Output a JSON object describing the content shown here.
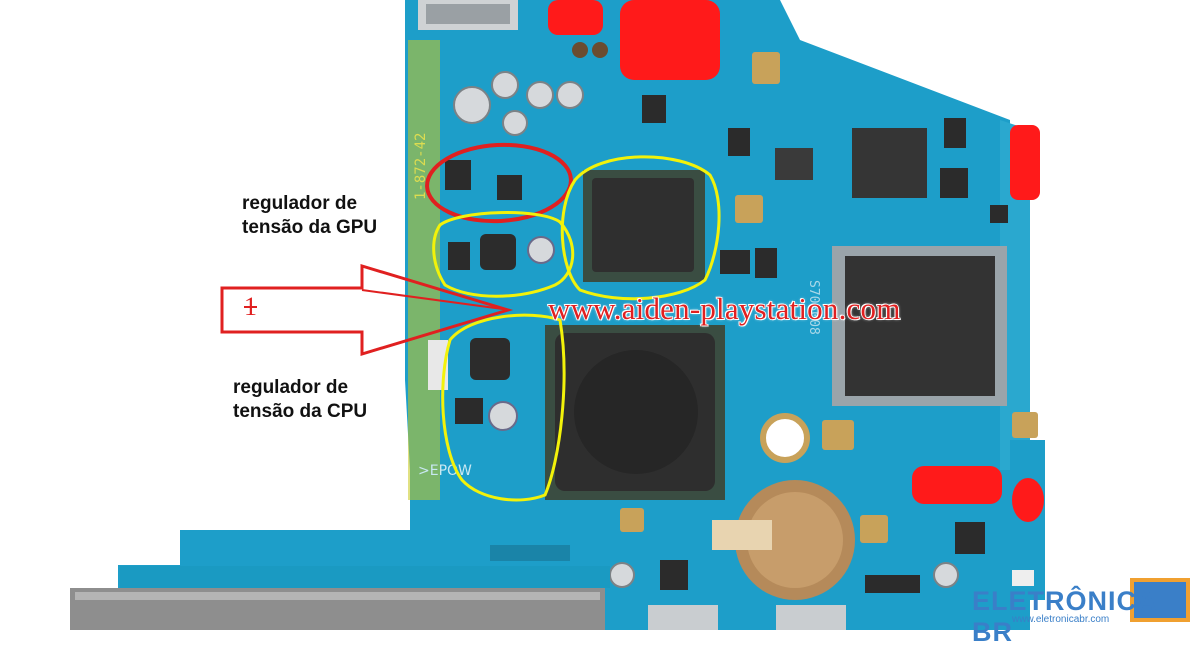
{
  "labels": {
    "gpu_line1": "regulador de",
    "gpu_line2": "tensão da GPU",
    "cpu_line1": "regulador de",
    "cpu_line2": "tensão da CPU",
    "marker": "1"
  },
  "watermark": "www.aiden-playstation.com",
  "logo": {
    "brand": "ELETRÔNICA BR",
    "url": "www.eletronicabr.com"
  },
  "colors": {
    "pcb": "#1a9bc4",
    "annotation_red": "#e02020",
    "annotation_yellow": "#f2f20a",
    "logo_blue": "#3a7fc8"
  }
}
